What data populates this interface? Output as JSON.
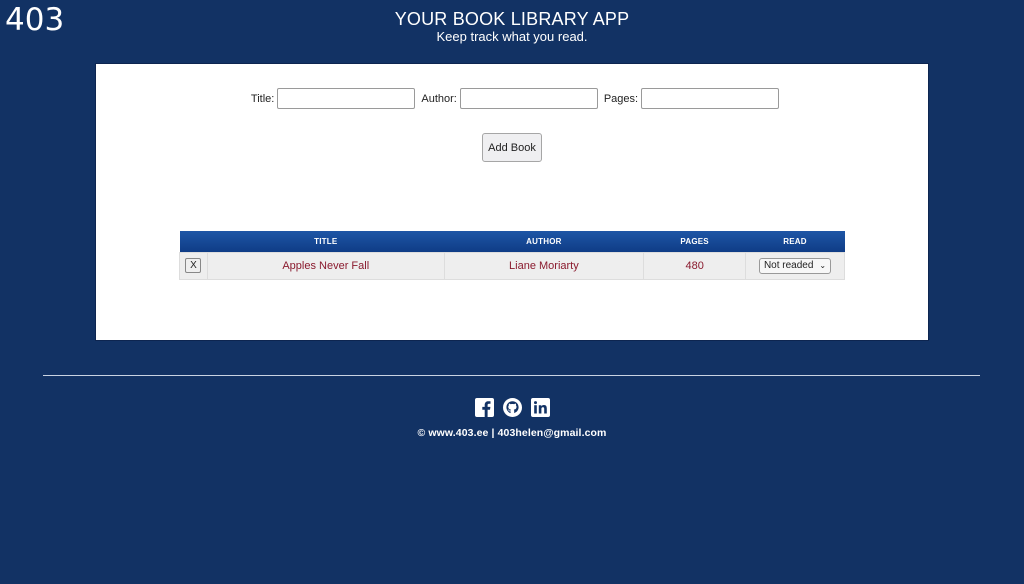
{
  "logo": "403",
  "header": {
    "title": "YOUR BOOK LIBRARY APP",
    "subtitle": "Keep track what you read."
  },
  "form": {
    "title_label": "Title:",
    "title_value": "",
    "author_label": "Author:",
    "author_value": "",
    "pages_label": "Pages:",
    "pages_value": "",
    "add_button": "Add Book"
  },
  "table": {
    "headers": [
      "",
      "TITLE",
      "AUTHOR",
      "PAGES",
      "READ"
    ],
    "rows": [
      {
        "delete": "X",
        "title": "Apples Never Fall",
        "author": "Liane Moriarty",
        "pages": "480",
        "read": "Not readed"
      }
    ]
  },
  "footer": {
    "social": [
      "facebook-icon",
      "github-icon",
      "linkedin-icon"
    ],
    "text": "© www.403.ee | 403helen@gmail.com"
  },
  "colors": {
    "background": "#123264",
    "table_header": "#1a4d9a",
    "cell_text": "#8a1a2e"
  }
}
